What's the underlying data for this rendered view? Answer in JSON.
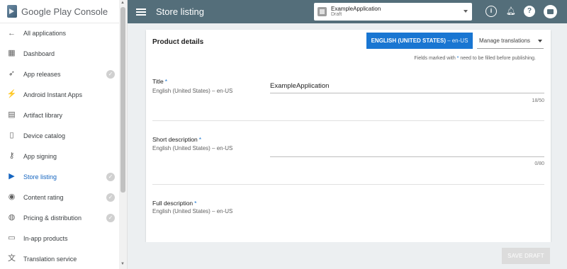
{
  "brand": {
    "name_part1": "Google Play",
    "name_part2": "Console"
  },
  "sidebar": {
    "back_label": "All applications",
    "items": [
      {
        "label": "Dashboard",
        "icon": "dashboard-icon",
        "glyph": "▦",
        "completed": false,
        "active": false
      },
      {
        "label": "App releases",
        "icon": "rocket-icon",
        "glyph": "🚀",
        "completed": true,
        "active": false
      },
      {
        "label": "Android Instant Apps",
        "icon": "lightning-icon",
        "glyph": "⚡",
        "completed": false,
        "active": false
      },
      {
        "label": "Artifact library",
        "icon": "library-icon",
        "glyph": "▤",
        "completed": false,
        "active": false
      },
      {
        "label": "Device catalog",
        "icon": "device-icon",
        "glyph": "▯",
        "completed": false,
        "active": false
      },
      {
        "label": "App signing",
        "icon": "key-icon",
        "glyph": "⚷",
        "completed": false,
        "active": false
      },
      {
        "label": "Store listing",
        "icon": "store-icon",
        "glyph": "▶",
        "completed": true,
        "active": true
      },
      {
        "label": "Content rating",
        "icon": "rating-icon",
        "glyph": "◉",
        "completed": true,
        "active": false
      },
      {
        "label": "Pricing & distribution",
        "icon": "globe-icon",
        "glyph": "◍",
        "completed": true,
        "active": false
      },
      {
        "label": "In-app products",
        "icon": "card-icon",
        "glyph": "▭",
        "completed": false,
        "active": false
      },
      {
        "label": "Translation service",
        "icon": "translate-icon",
        "glyph": "文",
        "completed": false,
        "active": false
      }
    ]
  },
  "header": {
    "title": "Store listing",
    "app_picker": {
      "name": "ExampleApplication",
      "status": "Draft"
    }
  },
  "card": {
    "title": "Product details",
    "language_chip": {
      "label": "ENGLISH (UNITED STATES)",
      "code": "– en-US"
    },
    "manage_translations": "Manage translations",
    "required_note_pre": "Fields marked with",
    "required_note_star": "*",
    "required_note_post": "need to be filled before publishing.",
    "fields": [
      {
        "label": "Title",
        "sub": "English (United States) – en-US",
        "value": "ExampleApplication",
        "counter": "18/50"
      },
      {
        "label": "Short description",
        "sub": "English (United States) – en-US",
        "value": "",
        "counter": "0/80"
      },
      {
        "label": "Full description",
        "sub": "English (United States) – en-US",
        "value": "",
        "counter": ""
      }
    ]
  },
  "footer": {
    "save_label": "SAVE DRAFT"
  },
  "colors": {
    "header": "#546e7a",
    "accent": "#1976d2",
    "active_nav": "#1565c0"
  }
}
